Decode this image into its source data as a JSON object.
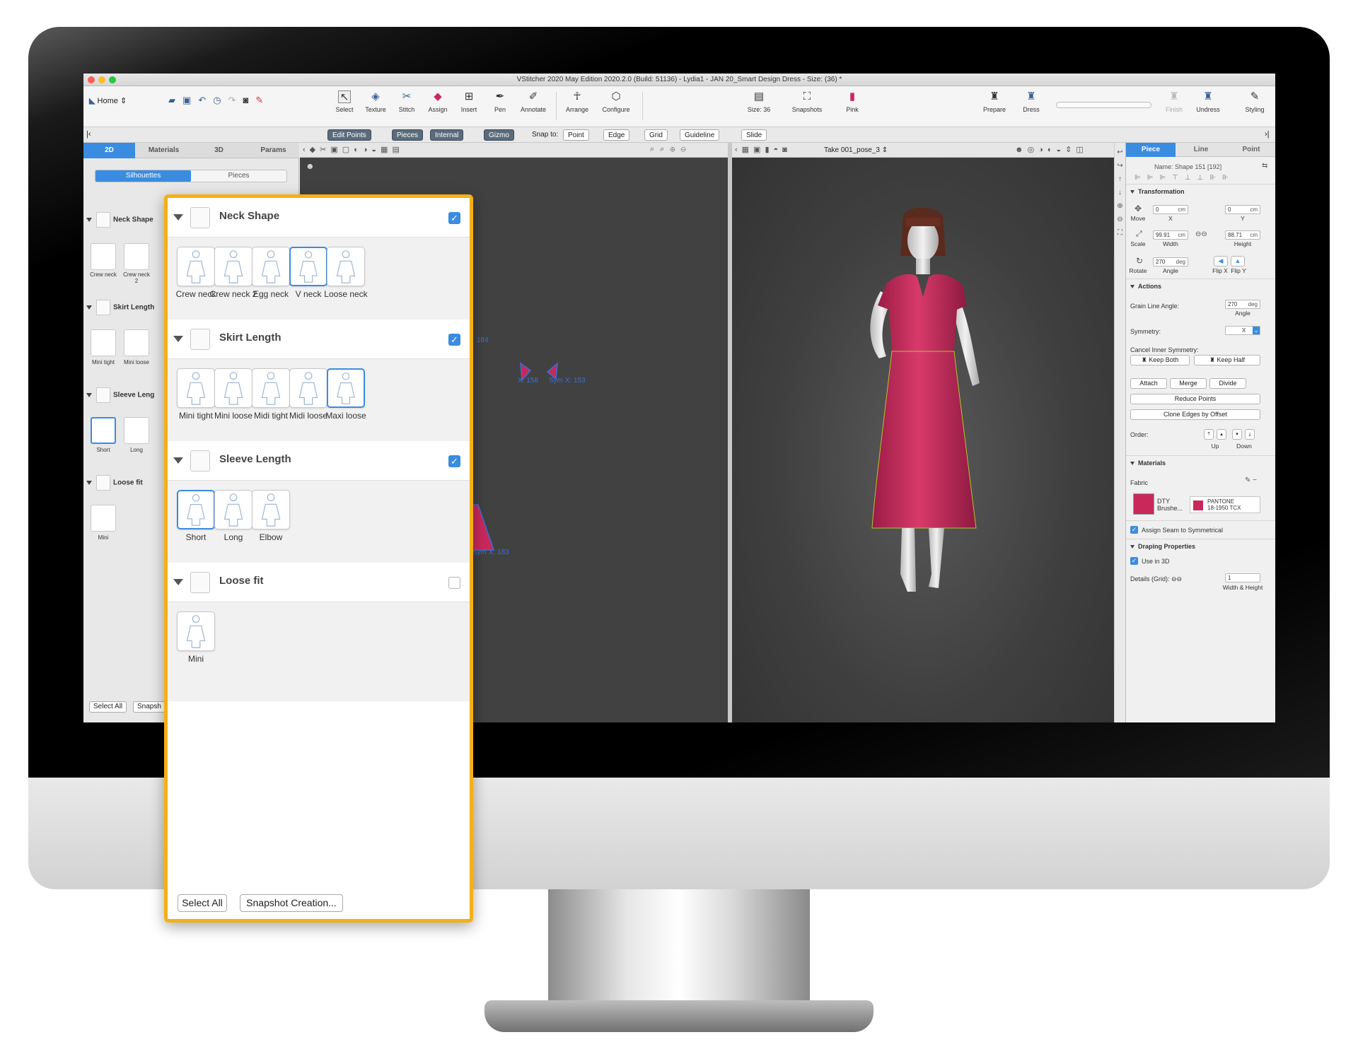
{
  "window": {
    "title": "VStitcher 2020 May Edition 2020.2.0 (Build: 51136) - Lydia1 - JAN 20_Smart Design Dress - Size: (36) *"
  },
  "toolbar": {
    "home": "Home",
    "tools": [
      "Select",
      "Texture",
      "Stitch",
      "Assign",
      "Insert",
      "Pen",
      "Annotate",
      "Arrange",
      "Configure"
    ],
    "size": "Size: 36",
    "snapshots": "Snapshots",
    "colorway": "Pink",
    "right_tools": [
      "Prepare",
      "Dress",
      "Finish",
      "Undress",
      "Styling"
    ]
  },
  "subbar": {
    "edit_points": "Edit Points",
    "pieces": "Pieces",
    "internal": "Internal",
    "gizmo": "Gizmo",
    "snap_to": "Snap to:",
    "point": "Point",
    "edge": "Edge",
    "grid": "Grid",
    "guideline": "Guideline",
    "slide": "Slide"
  },
  "left_panel": {
    "tabs": [
      "2D",
      "Materials",
      "3D",
      "Params"
    ],
    "active_tab": "2D",
    "segments": [
      "Silhouettes",
      "Pieces"
    ],
    "active_segment": "Silhouettes",
    "sections": [
      {
        "title": "Neck Shape",
        "items": [
          "Crew neck",
          "Crew neck 2",
          "E"
        ]
      },
      {
        "title": "Skirt Length",
        "items": [
          "Mini tight",
          "Mini loose",
          "M"
        ]
      },
      {
        "title": "Sleeve Leng",
        "items": [
          "Short",
          "Long",
          ""
        ]
      },
      {
        "title": "Loose fit",
        "items": [
          "Mini"
        ]
      }
    ],
    "select_all": "Select All",
    "snapshot": "Snapsh"
  },
  "view2d": {
    "labels": [
      "X: 158",
      "Sym X: 153",
      "184",
      "Sym X: 183"
    ]
  },
  "view3d": {
    "take": "Take 001_pose_3"
  },
  "right_panel": {
    "tabs": [
      "Piece",
      "Line",
      "Point"
    ],
    "active_tab": "Piece",
    "name": "Name: Shape 151 [192]",
    "transformation": "Transformation",
    "move": "Move",
    "move_x": "0",
    "move_y": "0",
    "unit_cm": "cm",
    "x_label": "X",
    "y_label": "Y",
    "scale": "Scale",
    "width_val": "99.91",
    "height_val": "88.71",
    "width_label": "Width",
    "height_label": "Height",
    "rotate": "Rotate",
    "angle_val": "270",
    "unit_deg": "deg",
    "angle_label": "Angle",
    "flip_x": "Flip X",
    "flip_y": "Flip Y",
    "actions": "Actions",
    "grain_line_angle": "Grain Line Angle:",
    "grain_val": "270",
    "symmetry": "Symmetry:",
    "symmetry_val": "X",
    "cancel_inner_symmetry": "Cancel Inner Symmetry:",
    "keep_both": "Keep Both",
    "keep_half": "Keep Half",
    "attach": "Attach",
    "merge": "Merge",
    "divide": "Divide",
    "reduce_points": "Reduce Points",
    "clone_edges": "Clone Edges by Offset",
    "order": "Order:",
    "up": "Up",
    "down": "Down",
    "materials": "Materials",
    "fabric": "Fabric",
    "fabric_name": "DTY Brushe...",
    "pantone_1": "PANTONE",
    "pantone_2": "18-1950 TCX",
    "assign_seam": "Assign Seam to Symmetrical",
    "draping": "Draping Properties",
    "use_in_3d": "Use in 3D",
    "details_grid": "Details (Grid):",
    "details_val": "1",
    "width_height": "Width & Height"
  },
  "zoom_panel": {
    "sections": [
      {
        "title": "Neck Shape",
        "checked": true,
        "items": [
          "Crew neck",
          "Crew neck 2",
          "Egg neck",
          "V neck",
          "Loose neck"
        ],
        "selected": 3
      },
      {
        "title": "Skirt Length",
        "checked": true,
        "items": [
          "Mini tight",
          "Mini loose",
          "Midi tight",
          "Midi loose",
          "Maxi loose"
        ],
        "selected": 4
      },
      {
        "title": "Sleeve Length",
        "checked": true,
        "items": [
          "Short",
          "Long",
          "Elbow"
        ],
        "selected": 0
      },
      {
        "title": "Loose fit",
        "checked": false,
        "items": [
          "Mini"
        ],
        "selected": -1
      }
    ],
    "select_all": "Select All",
    "snapshot_creation": "Snapshot Creation..."
  },
  "colors": {
    "accent": "#3a8ce0",
    "highlight": "#f4b015",
    "dress": "#c8285a"
  }
}
